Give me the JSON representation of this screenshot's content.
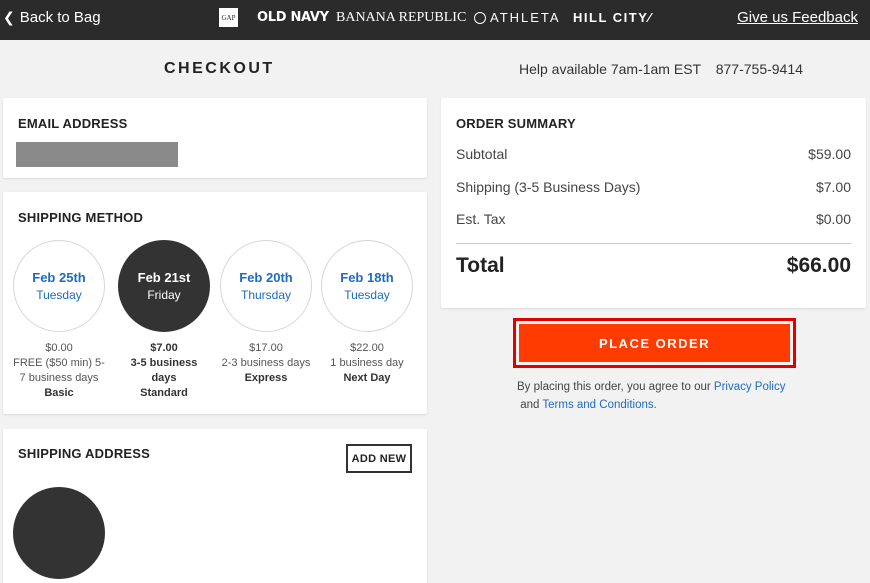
{
  "topbar": {
    "back_label": "Back to Bag",
    "brands": {
      "gap": "GAP",
      "old_navy": "OLD NAVY",
      "banana_republic": "BANANA REPUBLIC",
      "athleta": "ATHLETA",
      "hill_city": "HILL CITY∕"
    },
    "feedback_label": "Give us Feedback"
  },
  "header": {
    "title": "CHECKOUT",
    "help_text": "Help available 7am-1am EST",
    "phone": "877-755-9414"
  },
  "email": {
    "heading": "EMAIL ADDRESS"
  },
  "shipping_method": {
    "heading": "SHIPPING METHOD",
    "options": [
      {
        "date": "Feb 25th",
        "weekday": "Tuesday",
        "price": "$0.00",
        "desc": "FREE ($50 min) 5-7 business days",
        "name": "Basic",
        "selected": false
      },
      {
        "date": "Feb 21st",
        "weekday": "Friday",
        "price": "$7.00",
        "desc": "3-5 business days",
        "name": "Standard",
        "selected": true
      },
      {
        "date": "Feb 20th",
        "weekday": "Thursday",
        "price": "$17.00",
        "desc": "2-3 business days",
        "name": "Express",
        "selected": false
      },
      {
        "date": "Feb 18th",
        "weekday": "Tuesday",
        "price": "$22.00",
        "desc": "1 business day",
        "name": "Next Day",
        "selected": false
      }
    ]
  },
  "shipping_address": {
    "heading": "SHIPPING ADDRESS",
    "add_new_label": "ADD NEW"
  },
  "order_summary": {
    "heading": "ORDER SUMMARY",
    "rows": [
      {
        "label": "Subtotal",
        "value": "$59.00"
      },
      {
        "label": "Shipping (3-5 Business Days)",
        "value": "$7.00"
      },
      {
        "label": "Est. Tax",
        "value": "$0.00"
      }
    ],
    "total_label": "Total",
    "total_value": "$66.00"
  },
  "place_order": {
    "label": "PLACE ORDER",
    "agree_prefix": "By placing this order, you agree to our",
    "privacy_link": "Privacy Policy",
    "and_text": "and",
    "terms_link": "Terms and Conditions."
  },
  "colors": {
    "topbar_bg": "#2b2b2b",
    "accent_orange": "#ff3b00",
    "highlight_red": "#e00000",
    "link_blue": "#1f6bbf"
  }
}
